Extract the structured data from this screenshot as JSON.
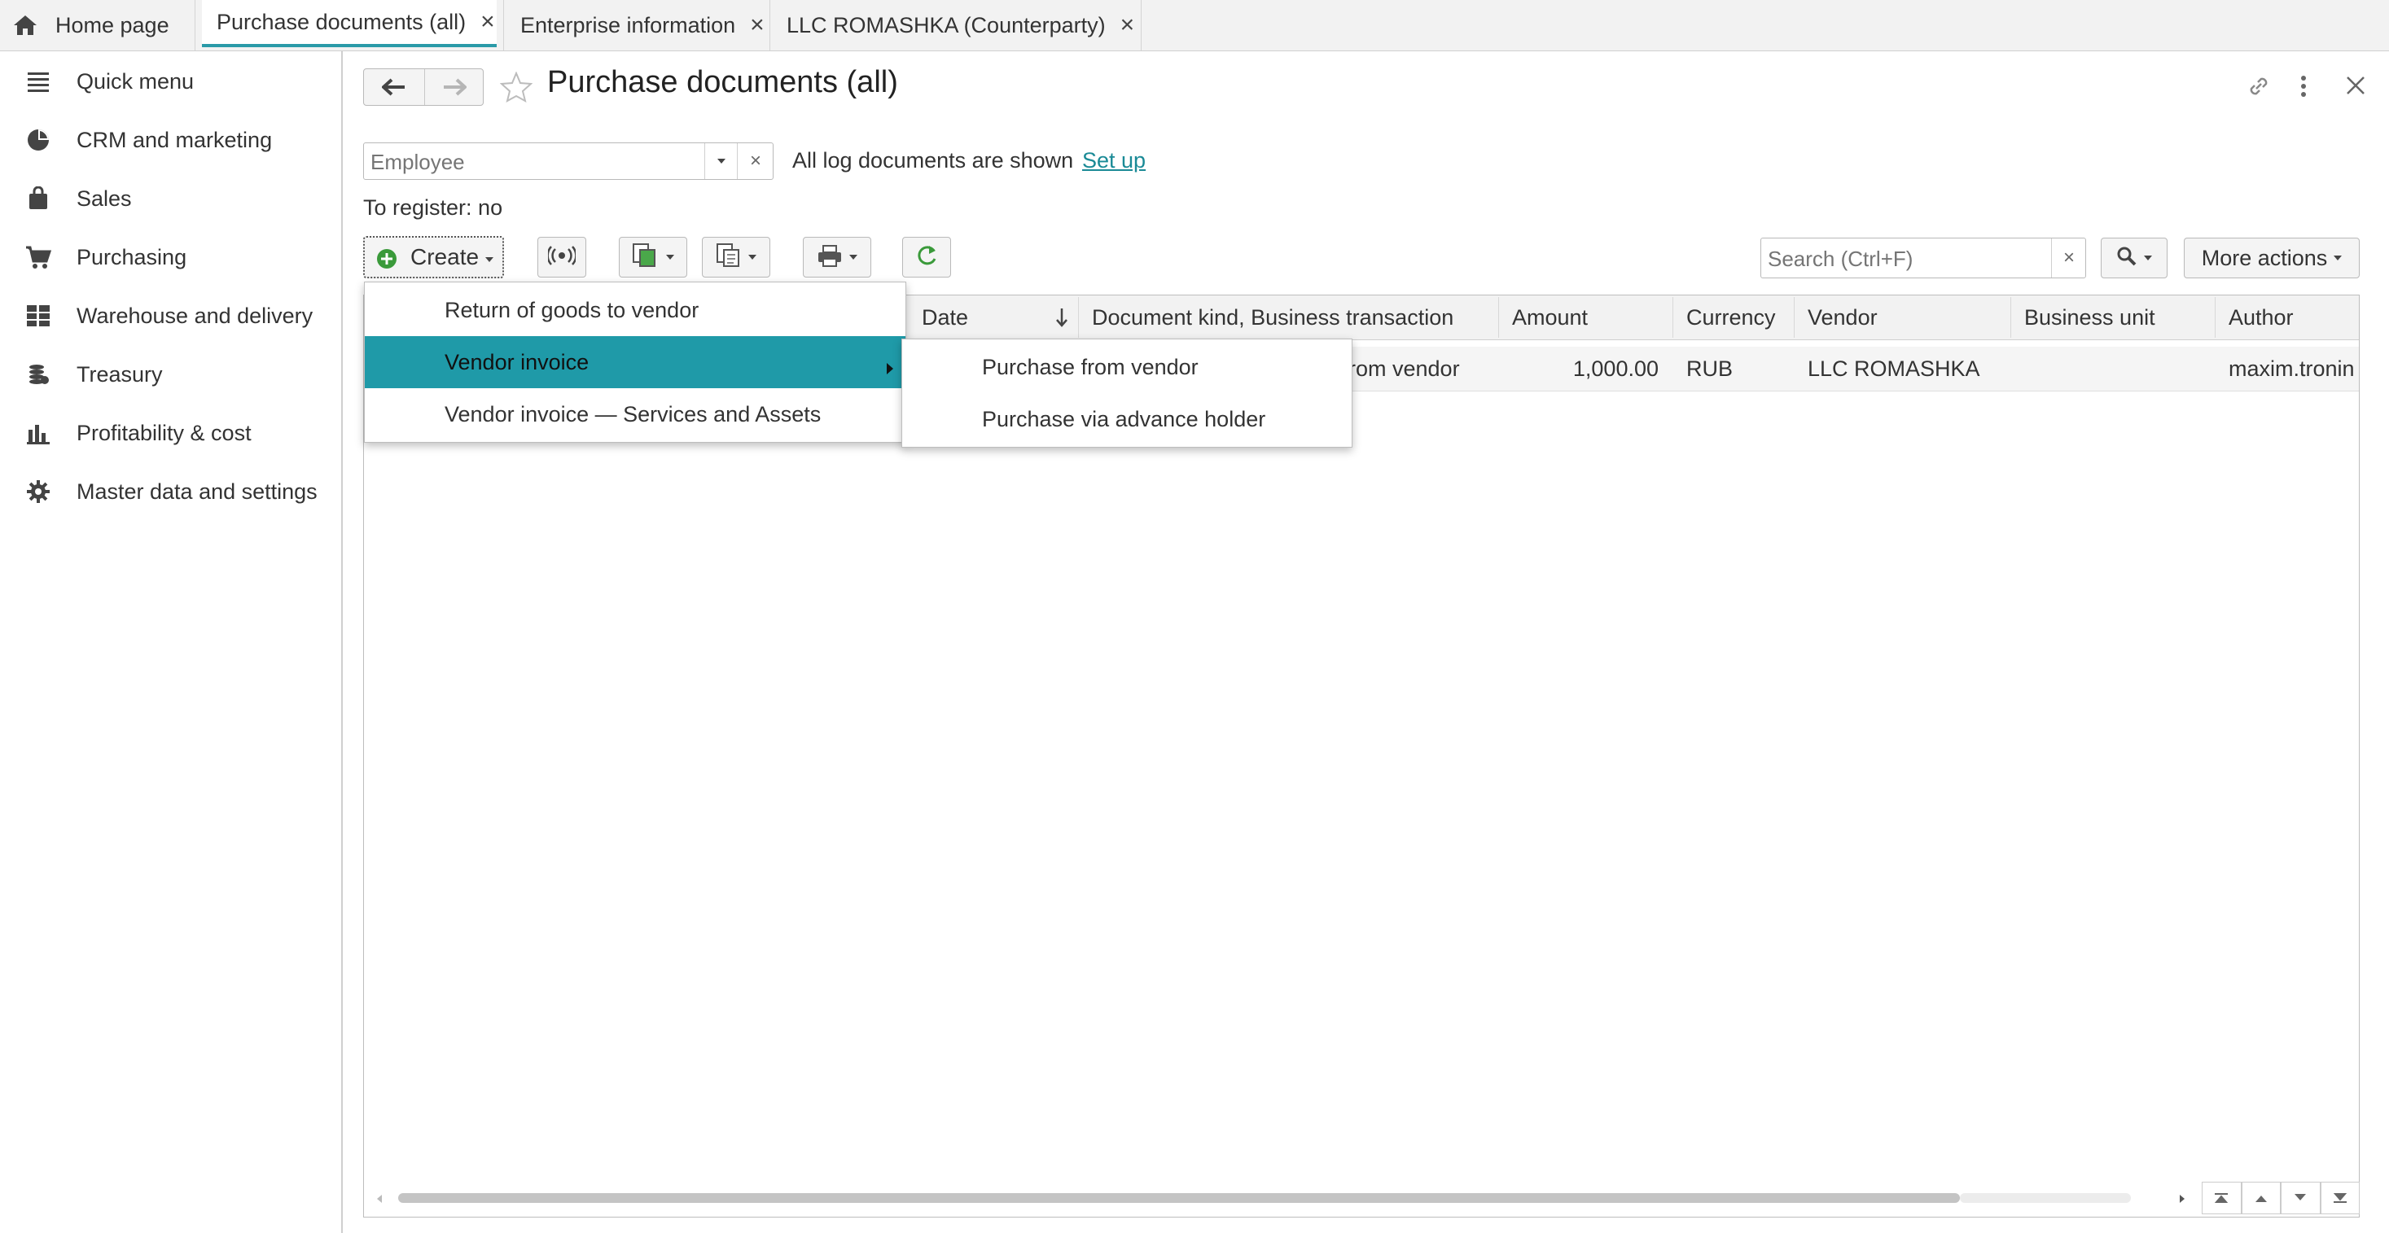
{
  "tabs": [
    {
      "label": "Home page"
    },
    {
      "label": "Purchase documents (all)"
    },
    {
      "label": "Enterprise information"
    },
    {
      "label": "LLC ROMASHKA (Counterparty)"
    }
  ],
  "sidebar": {
    "items": [
      {
        "label": "Quick menu",
        "icon": "menu-icon"
      },
      {
        "label": "CRM and marketing",
        "icon": "pie-chart-icon"
      },
      {
        "label": "Sales",
        "icon": "shopping-bag-icon"
      },
      {
        "label": "Purchasing",
        "icon": "cart-icon"
      },
      {
        "label": "Warehouse and delivery",
        "icon": "grid-icon"
      },
      {
        "label": "Treasury",
        "icon": "coins-icon"
      },
      {
        "label": "Profitability & cost",
        "icon": "bar-chart-icon"
      },
      {
        "label": "Master data and settings",
        "icon": "gear-icon"
      }
    ]
  },
  "page": {
    "title": "Purchase documents (all)",
    "employee_placeholder": "Employee",
    "log_info": "All log documents are shown",
    "setup_link": "Set up",
    "to_register": "To register: no",
    "create_label": "Create",
    "search_placeholder": "Search (Ctrl+F)",
    "more_actions": "More actions"
  },
  "table": {
    "columns": [
      "Date",
      "Document kind, Business transaction",
      "Amount",
      "Currency",
      "Vendor",
      "Business unit",
      "Author"
    ],
    "rows": [
      {
        "date": "",
        "kind": "rom vendor",
        "amount": "1,000.00",
        "currency": "RUB",
        "vendor": "LLC ROMASHKA",
        "business_unit": "",
        "author": "maxim.tronin"
      }
    ]
  },
  "create_menu": {
    "items": [
      "Return of goods to vendor",
      "Vendor invoice",
      "Vendor invoice — Services and Assets"
    ],
    "submenu": [
      "Purchase from vendor",
      "Purchase via advance holder"
    ]
  },
  "colors": {
    "accent": "#2a9aa8",
    "highlight": "#1f9aa8",
    "link": "#1a8a96",
    "refresh_green": "#3a9a3a"
  }
}
